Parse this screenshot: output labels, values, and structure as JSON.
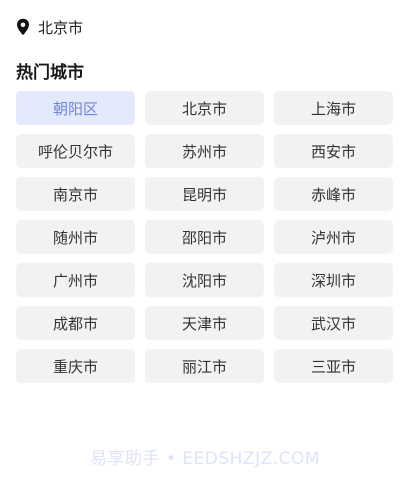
{
  "location": {
    "current_city": "北京市",
    "icon": "location-pin-icon"
  },
  "hot_cities": {
    "title": "热门城市",
    "items": [
      {
        "label": "朝阳区",
        "selected": true
      },
      {
        "label": "北京市",
        "selected": false
      },
      {
        "label": "上海市",
        "selected": false
      },
      {
        "label": "呼伦贝尔市",
        "selected": false
      },
      {
        "label": "苏州市",
        "selected": false
      },
      {
        "label": "西安市",
        "selected": false
      },
      {
        "label": "南京市",
        "selected": false
      },
      {
        "label": "昆明市",
        "selected": false
      },
      {
        "label": "赤峰市",
        "selected": false
      },
      {
        "label": "随州市",
        "selected": false
      },
      {
        "label": "邵阳市",
        "selected": false
      },
      {
        "label": "泸州市",
        "selected": false
      },
      {
        "label": "广州市",
        "selected": false
      },
      {
        "label": "沈阳市",
        "selected": false
      },
      {
        "label": "深圳市",
        "selected": false
      },
      {
        "label": "成都市",
        "selected": false
      },
      {
        "label": "天津市",
        "selected": false
      },
      {
        "label": "武汉市",
        "selected": false
      },
      {
        "label": "重庆市",
        "selected": false
      },
      {
        "label": "丽江市",
        "selected": false
      },
      {
        "label": "三亚市",
        "selected": false
      }
    ]
  },
  "watermark": "易享助手 • EEDSHZJZ.COM",
  "colors": {
    "selected_bg": "#e4e9fb",
    "selected_text": "#6e86e0",
    "button_bg": "#f2f2f4"
  }
}
